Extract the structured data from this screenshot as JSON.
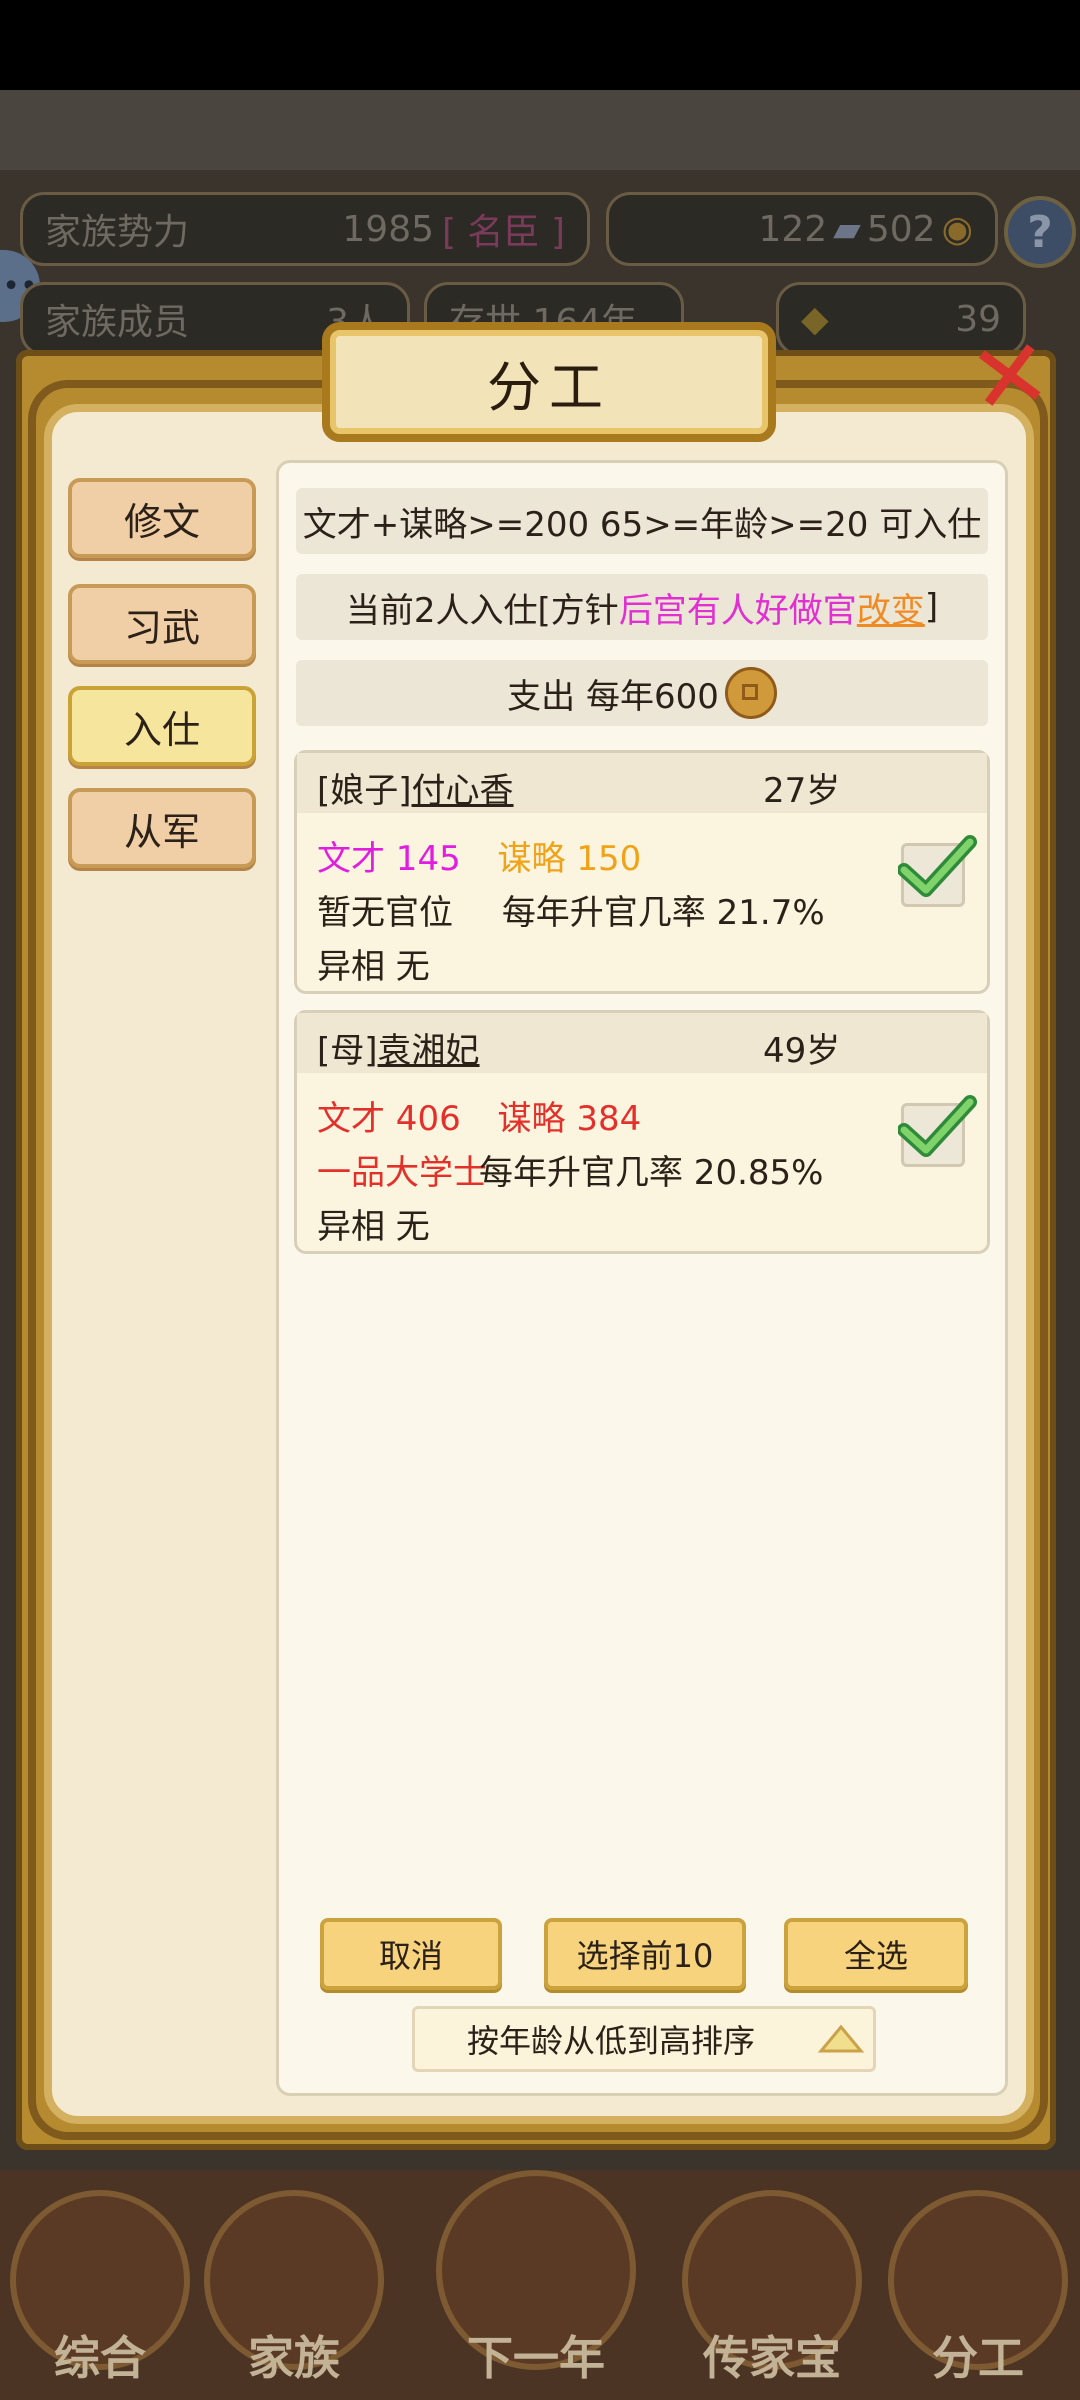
{
  "background": {
    "clan_power_label": "家族势力",
    "clan_power_value": "1985",
    "clan_power_rank": "[ 名臣 ]",
    "currency_a": "122",
    "currency_b": "502",
    "help": "?",
    "clan_members_label": "家族成员",
    "clan_members_value": "3人",
    "years_label": "存世 164年",
    "gold_value": "39"
  },
  "dialog": {
    "title": "分工",
    "close": "✕",
    "tabs": [
      {
        "label": "修文",
        "active": false
      },
      {
        "label": "习武",
        "active": false
      },
      {
        "label": "入仕",
        "active": true
      },
      {
        "label": "从军",
        "active": false
      }
    ],
    "requirement": "文才+谋略>=200 65>=年龄>=20 可入仕",
    "current": {
      "prefix": "当前2人入仕[方针",
      "policy": "后宫有人好做官",
      "change": "改变",
      "suffix": "]"
    },
    "expense": "支出 每年600",
    "people": [
      {
        "name_prefix": "[娘子]",
        "name": "付心香",
        "age": "27岁",
        "wencai": "文才 145",
        "moulue": "谋略 150",
        "post": "暂无官位",
        "promote": "每年升官几率 21.7%",
        "trait": "异相 无",
        "checked": true
      },
      {
        "name_prefix": "[母]",
        "name": "袁湘妃",
        "age": "49岁",
        "wencai": "文才 406",
        "moulue": "谋略 384",
        "post": "一品大学士",
        "promote": "每年升官几率 20.85%",
        "trait": "异相 无",
        "checked": true
      }
    ],
    "buttons": {
      "cancel": "取消",
      "top10": "选择前10",
      "all": "全选"
    },
    "sort_label": "按年龄从低到高排序"
  },
  "nav": [
    "综合",
    "家族",
    "下一年",
    "传家宝",
    "分工"
  ],
  "colors": {
    "magenta": "#e11ee0",
    "gold": "#f0a219",
    "red": "#e3302a",
    "accent_orange": "#f08b24"
  }
}
